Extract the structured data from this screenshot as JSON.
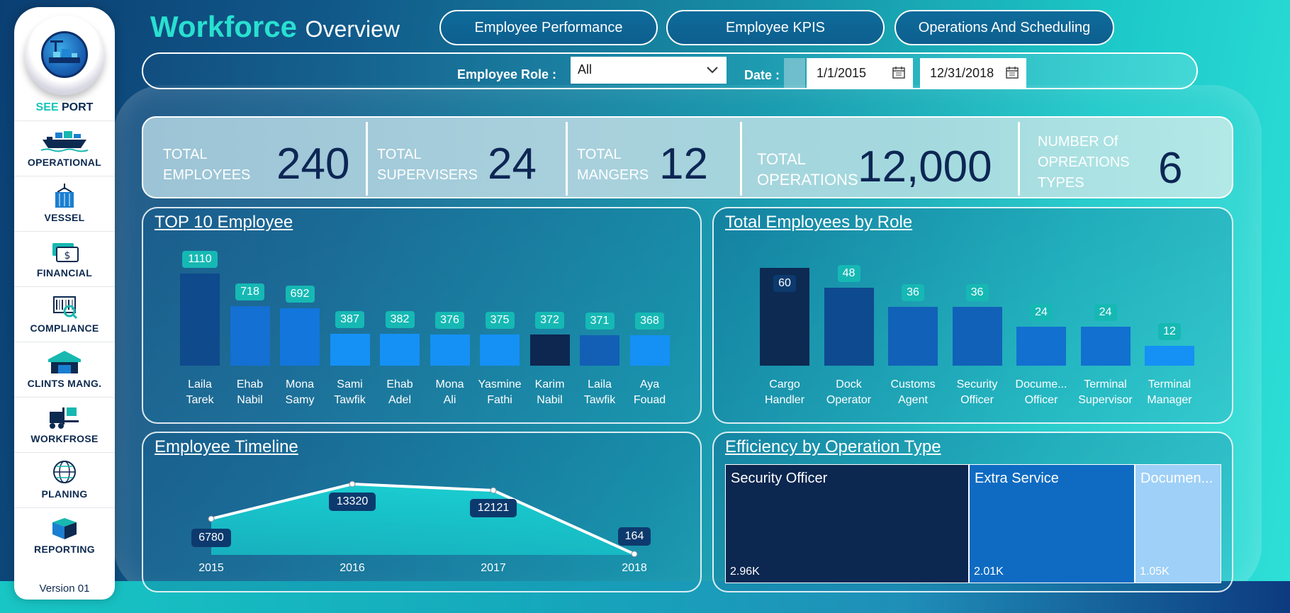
{
  "header": {
    "title_bold": "Workforce",
    "title_rest": "Overview",
    "tabs": [
      {
        "label": "Employee Performance"
      },
      {
        "label": "Employee KPIS"
      },
      {
        "label": "Operations And Scheduling"
      }
    ]
  },
  "filters": {
    "role_label": "Employee Role :",
    "role_value": "All",
    "date_label": "Date :",
    "date_start": "1/1/2015",
    "date_end": "12/31/2018"
  },
  "sidebar": {
    "brand_see": "SEE",
    "brand_port": "PORT",
    "items": [
      {
        "label": "OPERATIONAL",
        "icon": "ship-icon"
      },
      {
        "label": "VESSEL",
        "icon": "container-icon"
      },
      {
        "label": "FINANCIAL",
        "icon": "money-icon"
      },
      {
        "label": "COMPLIANCE",
        "icon": "barcode-icon"
      },
      {
        "label": "CLINTS MANG.",
        "icon": "warehouse-icon"
      },
      {
        "label": "WORKFROSE",
        "icon": "forklift-icon"
      },
      {
        "label": "PLANING",
        "icon": "globe-icon"
      },
      {
        "label": "REPORTING",
        "icon": "box-icon"
      }
    ],
    "version": "Version 01"
  },
  "kpis": [
    {
      "label": "TOTAL\nEMPLOYEES",
      "value": "240"
    },
    {
      "label": "TOTAL\nSUPERVISERS",
      "value": "24"
    },
    {
      "label": "TOTAL\nMANGERS",
      "value": "12"
    },
    {
      "label": "TOTAL\nOPERATIONS",
      "value": "12,000"
    },
    {
      "label": "NUMBER Of\nOPREATIONS\nTYPES",
      "value": "6"
    }
  ],
  "colors": {
    "accent": "#28e0d0",
    "navy": "#0d2654",
    "bar_dark": "#0d2f5e",
    "bar_mid": "#0e4a8f",
    "bar_blue": "#1265c2",
    "bar_bright": "#1590f5",
    "bar_medium": "#1276dc"
  },
  "chart_data": [
    {
      "type": "bar",
      "title": "TOP 10 Employee",
      "categories": [
        "Laila\nTarek",
        "Ehab\nNabil",
        "Mona\nSamy",
        "Sami\nTawfik",
        "Ehab\nAdel",
        "Mona\nAli",
        "Yasmine\nFathi",
        "Karim\nNabil",
        "Laila\nTawfik",
        "Aya\nFouad"
      ],
      "values": [
        1110,
        718,
        692,
        387,
        382,
        376,
        375,
        372,
        371,
        368
      ],
      "bar_colors": [
        "#0f4a8c",
        "#1470d2",
        "#1276dc",
        "#1590f5",
        "#1590f5",
        "#1590f5",
        "#1590f5",
        "#0d2750",
        "#125fb5",
        "#1590f5"
      ]
    },
    {
      "type": "bar",
      "title": "Total Employees by Role",
      "categories": [
        "Cargo\nHandler",
        "Dock\nOperator",
        "Customs\nAgent",
        "Security\nOfficer",
        "Docume...\nOfficer",
        "Terminal\nSupervisor",
        "Terminal\nManager"
      ],
      "values": [
        60,
        48,
        36,
        36,
        24,
        24,
        12
      ],
      "bar_colors": [
        "#0c2a52",
        "#0e4a8f",
        "#1161b8",
        "#1161b8",
        "#1270d0",
        "#1270d0",
        "#1590f5"
      ]
    },
    {
      "type": "line",
      "title": "Employee Timeline",
      "x": [
        "2015",
        "2016",
        "2017",
        "2018"
      ],
      "values": [
        6780,
        13320,
        12121,
        164
      ]
    },
    {
      "type": "treemap",
      "title": "Efficiency by Operation Type",
      "items": [
        {
          "name": "Security Officer",
          "label": "2.96K",
          "value": 2960,
          "color": "#0c2750"
        },
        {
          "name": "Extra Service",
          "label": "2.01K",
          "value": 2010,
          "color": "#0f6bc2"
        },
        {
          "name": "Documen...",
          "label": "1.05K",
          "value": 1050,
          "color": "#9fd0f7"
        }
      ]
    }
  ]
}
